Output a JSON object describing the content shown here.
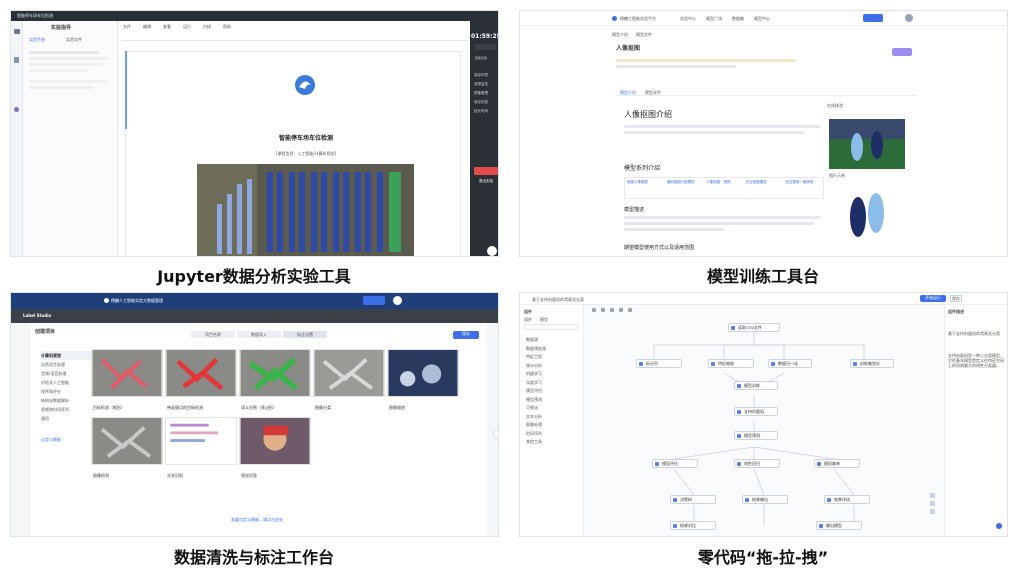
{
  "captions": {
    "tl": "Jupyter数据分析实验工具",
    "tr": "模型训练工具台",
    "bl": "数据清洗与标注工作台",
    "br": "零代码“拖-拉-拽”"
  },
  "jupyter": {
    "app_title": "智能停车场车位检测",
    "timer": "01:59:25",
    "menu": [
      "文件",
      "编辑",
      "查看",
      "运行",
      "内核",
      "帮助"
    ],
    "tabs": [
      "实验手册",
      "实验文件"
    ],
    "sidebar_title": "实验指导",
    "doc_title": "智能停车场车位检测",
    "doc_subtitle": "[课程信息：人工智能/计算机视觉]",
    "right_panel": [
      "结束实验",
      "保存环境",
      "资源监控",
      "镜像管理",
      "保存实验",
      "延长时间",
      "退出实验"
    ],
    "accent": "#e34b4b",
    "dark": "#2b2f36"
  },
  "model_train": {
    "platform_name": "德麟工智能实验平台",
    "nav": [
      "实验中心",
      "模型广场",
      "数据集",
      "模型中心"
    ],
    "page_title": "人像抠图",
    "tabs": [
      "模型介绍",
      "模型文件"
    ],
    "h1": "人像抠图介绍",
    "h2": "模型系列介绍",
    "h3": "模型描述",
    "h4": "期望模型使用方式以及适用范围",
    "table_cells": [
      "抠图人像模型",
      "通用抠图分割模型",
      "人像抠图 · 视频",
      "天空抠图模型",
      "天空替换一键体验"
    ],
    "side_title": "在线体验",
    "side_label2": "图片示例",
    "button": "在线体验"
  },
  "annotate": {
    "app_title": "德麟人工智能实验大数据管理",
    "studio_title": "Label Studio",
    "left_title": "创建项目",
    "steps": [
      "项目名称",
      "数据导入",
      "标注设置"
    ],
    "save_label": "保存",
    "categories": [
      "计算机视觉",
      "自然语言处理",
      "音频/语音处理",
      "对话式人工智能",
      "排序和评分",
      "结构化数据解析",
      "视频和时间序列",
      "通用"
    ],
    "link": "自定义模板",
    "thumbnails": [
      "目标检测（矩形）",
      "带关键点的目标检测",
      "语义分割（多边形）",
      "图像分类",
      "图像描述",
      "图像检测",
      "光学识别",
      "视觉问答"
    ],
    "footer_text": "若要自定义模板，请点击此处"
  },
  "nocode": {
    "title": "基于支持向量机的鸢尾花分类",
    "run_button": "开始运行",
    "save_button": "保存",
    "left_title": "组件",
    "left_tabs": [
      "组件",
      "模型"
    ],
    "components": [
      "数据源",
      "数据预处理",
      "特征工程",
      "统计分析",
      "机器学习",
      "深度学习",
      "模型评估",
      "模型预测",
      "可视化",
      "文本分析",
      "图像处理",
      "时间序列",
      "其他工具"
    ],
    "nodes": [
      "读取.csv文件",
      "拆分列",
      "特征缩放",
      "数据归一化",
      "训练集划分",
      "模型训练",
      "支持向量机",
      "模型预测",
      "模型评估",
      "线性回归",
      "随机森林",
      "决策树",
      "结果输出",
      "效果评估",
      "结果对比",
      "输出模型"
    ],
    "right_title": "组件描述",
    "right_heading": "基于支持向量机的鸢尾花分类",
    "right_text": "支持向量机是一种二分类模型，它的基本模型是定义在特征空间上的间隔最大的线性分类器。"
  }
}
